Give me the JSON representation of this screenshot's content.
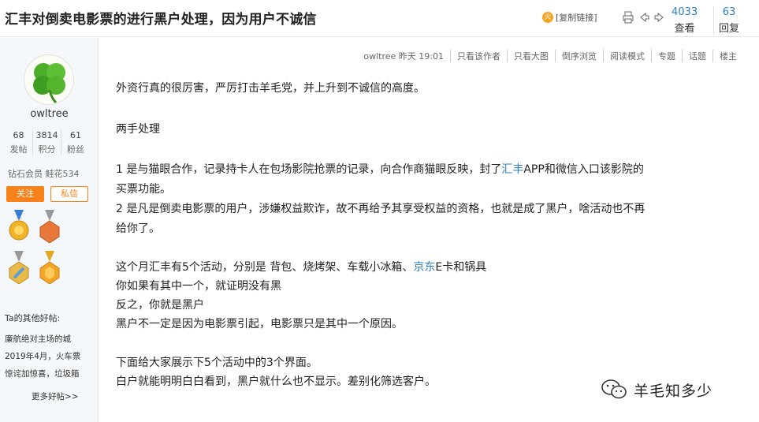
{
  "header": {
    "title": "汇丰对倒卖电影票的进行黑户处理，因为用户不诚信",
    "copy_link": "[复制链接]",
    "fire_icon": "火",
    "views": "4033",
    "views_label": "查看",
    "replies": "63",
    "replies_label": "回复"
  },
  "author": {
    "name": "owltree",
    "stats": [
      {
        "value": "68",
        "label": "发帖"
      },
      {
        "value": "3814",
        "label": "积分"
      },
      {
        "value": "61",
        "label": "粉丝"
      }
    ],
    "rank": "钻石会员 鲑花534",
    "follow": "关注",
    "message": "私信",
    "other_posts_title": "Ta的其他好帖:",
    "other_posts": [
      "廉航绝对主场的城",
      "2019年4月，火车票",
      "惊诧加惊喜，垃圾箱"
    ],
    "more_posts": "更多好帖>>"
  },
  "meta": {
    "author_time": "owltree 昨天 19:01",
    "items": [
      "只看该作者",
      "只看大图",
      "倒序浏览",
      "阅读模式",
      "专题",
      "话题",
      "楼主"
    ]
  },
  "post": {
    "line1": "外资行真的很厉害，严厉打击羊毛党，并上升到不诚信的高度。",
    "line2": "两手处理",
    "line3a": "1 是与猫眼合作，记录持卡人在包场影院抢票的记录，向合作商猫眼反映，封了",
    "line3link": "汇丰",
    "line3b": "APP和微信入口该影院的",
    "line4": "买票功能。",
    "line5": "2 是凡是倒卖电影票的用户，涉嫌权益欺诈，故不再给予其享受权益的资格，也就是成了黑户，啥活动也不再",
    "line6": "给你了。",
    "line7a": "这个月汇丰有5个活动，分别是 背包、烧烤架、车载小冰箱、",
    "line7link": "京东",
    "line7b": "E卡和锅具",
    "line8": "你如果有其中一个，就证明没有黑",
    "line9": "反之，你就是黑户",
    "line10": "黑户不一定是因为电影票引起，电影票只是其中一个原因。",
    "line11": "下面给大家展示下5个活动中的3个界面。",
    "line12": "白户就能明明白白看到，黑户就什么也不显示。差别化筛选客户。"
  },
  "watermark": "羊毛知多少",
  "colors": {
    "accent": "#f7821b",
    "link": "#2b7fc4",
    "sidebar_bg": "#f5f8fa"
  }
}
